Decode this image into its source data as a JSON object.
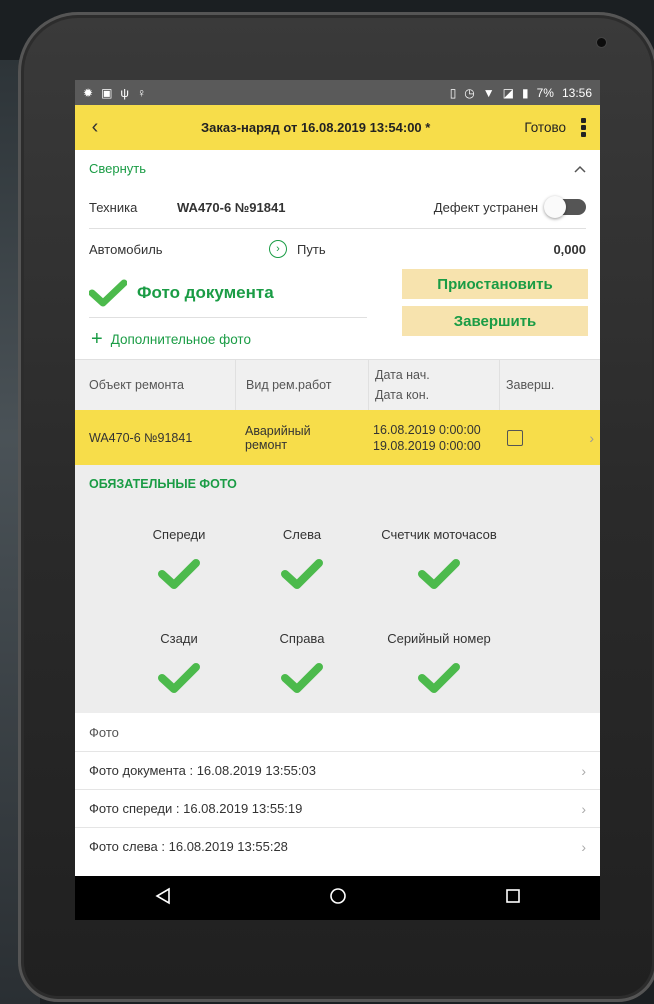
{
  "statusbar": {
    "battery": "7%",
    "time": "13:56"
  },
  "topbar": {
    "title": "Заказ-наряд  от 16.08.2019 13:54:00 *",
    "done_label": "Готово"
  },
  "section": {
    "collapse_label": "Свернуть"
  },
  "equipment": {
    "label": "Техника",
    "value": "WA470-6 №91841",
    "defect_label": "Дефект устранен",
    "defect_fixed": false
  },
  "car": {
    "label": "Автомобиль",
    "path_label": "Путь",
    "path_value": "0,000"
  },
  "doc": {
    "photo_label": "Фото документа",
    "add_photo_label": "Дополнительное фото"
  },
  "buttons": {
    "suspend": "Приостановить",
    "finish": "Завершить"
  },
  "table": {
    "headers": {
      "object": "Объект ремонта",
      "work_type": "Вид рем.работ",
      "date_start": "Дата нач.",
      "date_end": "Дата кон.",
      "done": "Заверш."
    },
    "rows": [
      {
        "object": "WA470-6 №91841",
        "work_type_1": "Аварийный",
        "work_type_2": "ремонт",
        "date_start": "16.08.2019 0:00:00",
        "date_end": "19.08.2019 0:00:00",
        "done": false
      }
    ]
  },
  "mandatory": {
    "title": "ОБЯЗАТЕЛЬНЫЕ ФОТО",
    "items": [
      "Спереди",
      "Слева",
      "Счетчик моточасов",
      "Сзади",
      "Справа",
      "Серийный номер"
    ]
  },
  "photos": {
    "label": "Фото",
    "items": [
      "Фото документа : 16.08.2019 13:55:03",
      "Фото спереди : 16.08.2019 13:55:19",
      "Фото слева : 16.08.2019 13:55:28"
    ]
  },
  "colors": {
    "accent_green": "#1a9c45",
    "header_yellow": "#f7dd4a",
    "button_bg": "#f7e3ae"
  }
}
